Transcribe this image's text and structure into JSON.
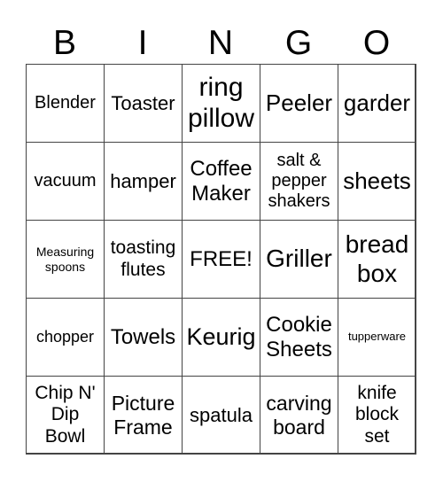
{
  "header": [
    "B",
    "I",
    "N",
    "G",
    "O"
  ],
  "cells": [
    "Blender",
    "Toaster",
    "ring\npillow",
    "Peeler",
    "garder",
    "vacuum",
    "hamper",
    "Coffee\nMaker",
    "salt &\npepper\nshakers",
    "sheets",
    "Measuring\nspoons",
    "toasting\nflutes",
    "FREE!",
    "Griller",
    "bread\nbox",
    "chopper",
    "Towels",
    "Keurig",
    "Cookie\nSheets",
    "tupperware",
    "Chip N'\nDip\nBowl",
    "Picture\nFrame",
    "spatula",
    "carving\nboard",
    "knife\nblock\nset"
  ]
}
